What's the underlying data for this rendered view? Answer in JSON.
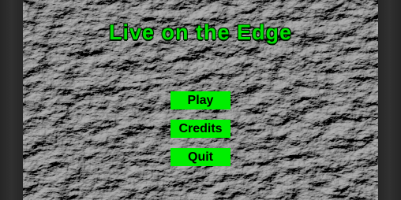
{
  "game": {
    "title": "Live on the Edge"
  },
  "menu": {
    "play_label": "Play",
    "credits_label": "Credits",
    "quit_label": "Quit"
  },
  "colors": {
    "title_green": "#00e000",
    "button_green": "#00ee00",
    "button_text": "#000000",
    "rock_gray": "#4a4a4a"
  }
}
